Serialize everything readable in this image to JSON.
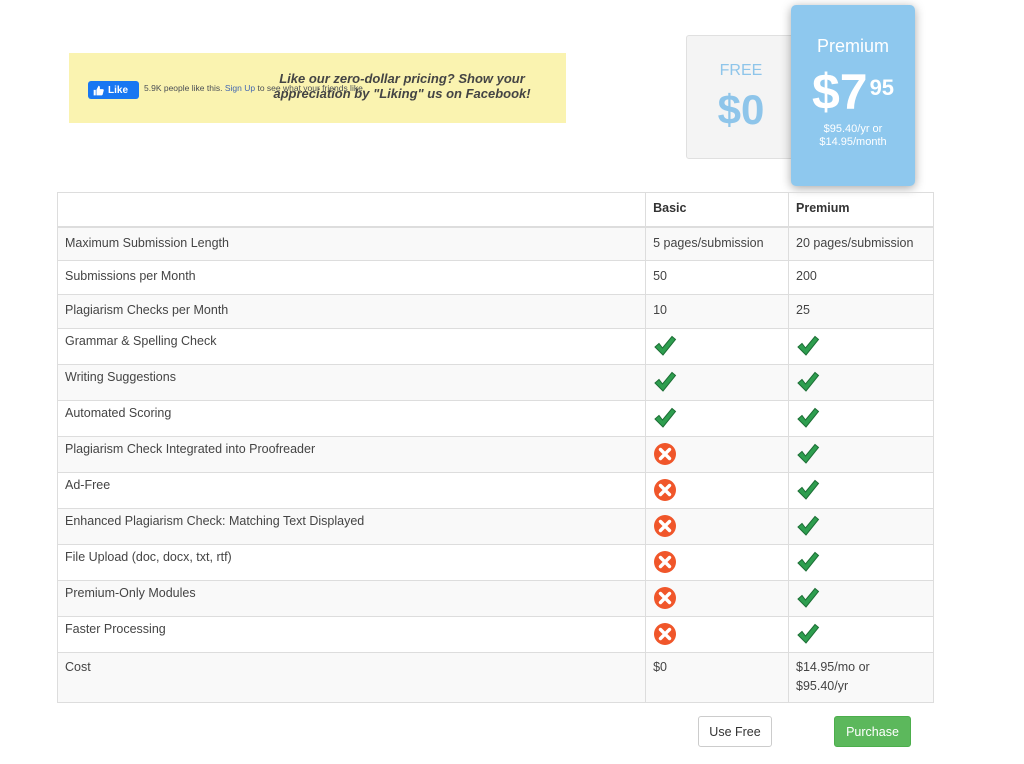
{
  "facebook_banner": {
    "like_button_label": "Like",
    "like_count_text": "5.9K people like this.",
    "signup_link": "Sign Up",
    "signup_suffix": "to see what your friends like.",
    "promo_text": "Like our zero-dollar pricing? Show your appreciation by \"Liking\" us on Facebook!"
  },
  "plans": {
    "free": {
      "tier": "FREE",
      "price": "$0"
    },
    "premium": {
      "tier": "Premium",
      "price_dollars": "$7",
      "price_cents": "95",
      "alt_price_line1": "$95.40/yr or",
      "alt_price_line2": "$14.95/month"
    }
  },
  "table": {
    "headers": [
      "",
      "Basic",
      "Premium"
    ],
    "rows": [
      {
        "feature": "Maximum Submission Length",
        "basic": "5 pages/submission",
        "premium": "20 pages/submission"
      },
      {
        "feature": "Submissions per Month",
        "basic": "50",
        "premium": "200"
      },
      {
        "feature": "Plagiarism Checks per Month",
        "basic": "10",
        "premium": "25"
      },
      {
        "feature": "Grammar & Spelling Check",
        "basic": "check",
        "premium": "check"
      },
      {
        "feature": "Writing Suggestions",
        "basic": "check",
        "premium": "check"
      },
      {
        "feature": "Automated Scoring",
        "basic": "check",
        "premium": "check"
      },
      {
        "feature": "Plagiarism Check Integrated into Proofreader",
        "basic": "cross",
        "premium": "check"
      },
      {
        "feature": "Ad-Free",
        "basic": "cross",
        "premium": "check"
      },
      {
        "feature": "Enhanced Plagiarism Check: Matching Text Displayed",
        "basic": "cross",
        "premium": "check"
      },
      {
        "feature": "File Upload (doc, docx, txt, rtf)",
        "basic": "cross",
        "premium": "check"
      },
      {
        "feature": "Premium-Only Modules",
        "basic": "cross",
        "premium": "check"
      },
      {
        "feature": "Faster Processing",
        "basic": "cross",
        "premium": "check"
      },
      {
        "feature": "Cost",
        "basic": "$0",
        "premium": "$14.95/mo or\n$95.40/yr"
      }
    ]
  },
  "actions": {
    "use_free_label": "Use Free",
    "purchase_label": "Purchase"
  },
  "colors": {
    "accent_blue": "#8ec8ee",
    "purchase_green": "#5cb85c",
    "check_green": "#2e9e4f",
    "cross_orange": "#f0562a",
    "banner_yellow": "#faf3b0"
  }
}
